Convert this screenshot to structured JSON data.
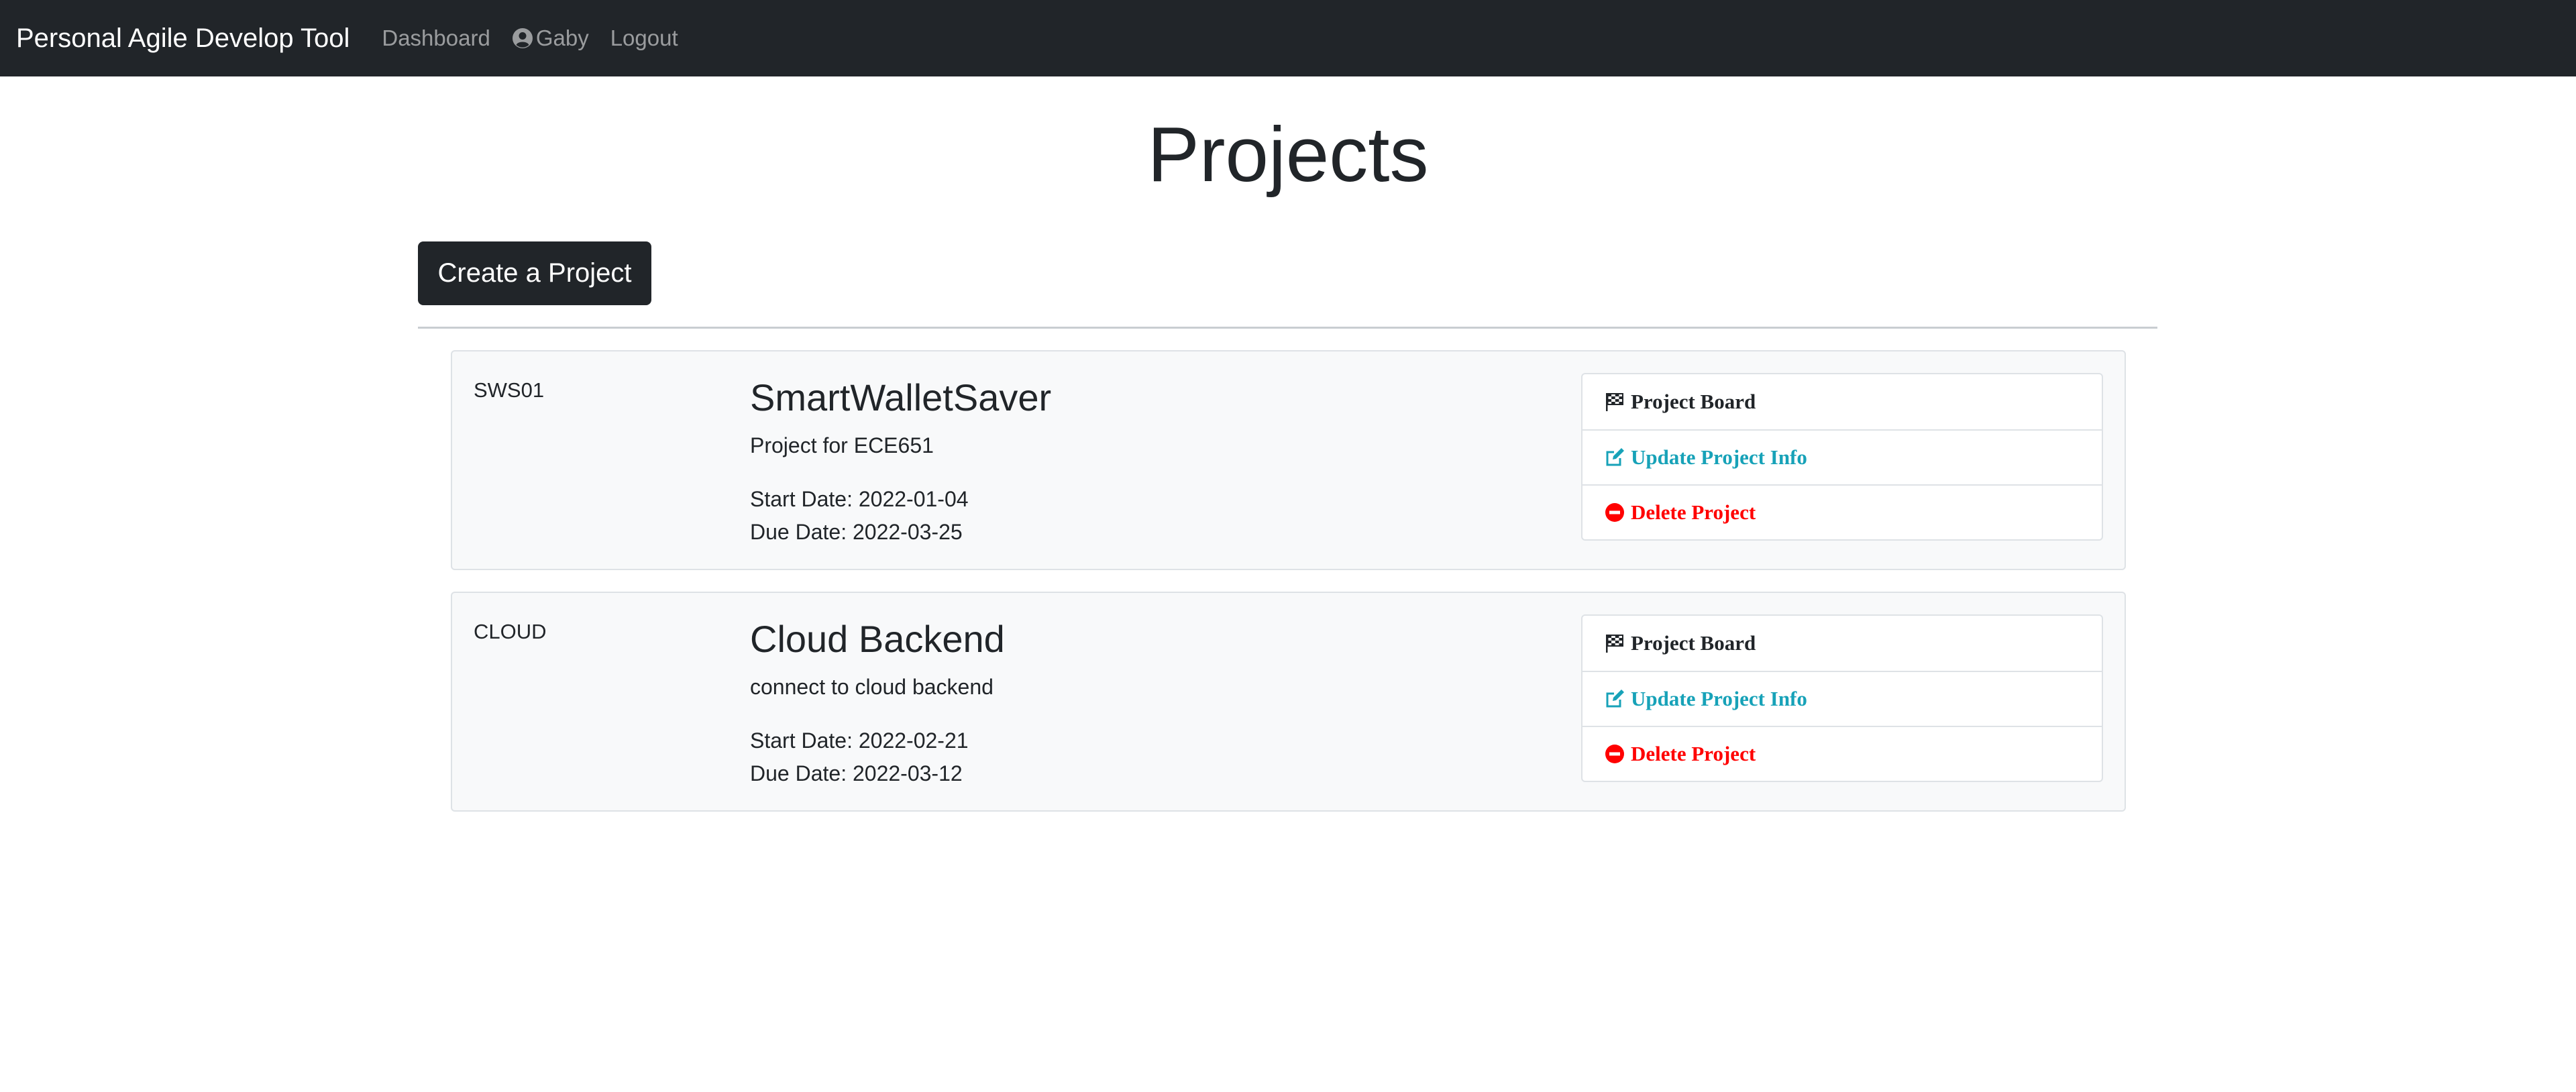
{
  "navbar": {
    "brand": "Personal Agile Develop Tool",
    "links": {
      "dashboard": "Dashboard",
      "user": "Gaby",
      "logout": "Logout"
    }
  },
  "page": {
    "title": "Projects",
    "create_button": "Create a Project"
  },
  "projects": [
    {
      "code": "SWS01",
      "name": "SmartWalletSaver",
      "description": "Project for ECE651",
      "start": "Start Date: 2022-01-04",
      "due": "Due Date: 2022-03-25",
      "actions": {
        "board": "Project Board",
        "update": "Update Project Info",
        "delete": "Delete Project"
      }
    },
    {
      "code": "CLOUD",
      "name": "Cloud Backend",
      "description": "connect to cloud backend",
      "start": "Start Date: 2022-02-21",
      "due": "Due Date: 2022-03-12",
      "actions": {
        "board": "Project Board",
        "update": "Update Project Info",
        "delete": "Delete Project"
      }
    }
  ],
  "icons": {
    "board": "flag-checkered-icon",
    "update": "edit-icon",
    "delete": "minus-circle-icon",
    "user": "user-circle-icon"
  },
  "colors": {
    "navbar": "#212529",
    "update": "#17a2b8",
    "delete": "#ff0000"
  }
}
